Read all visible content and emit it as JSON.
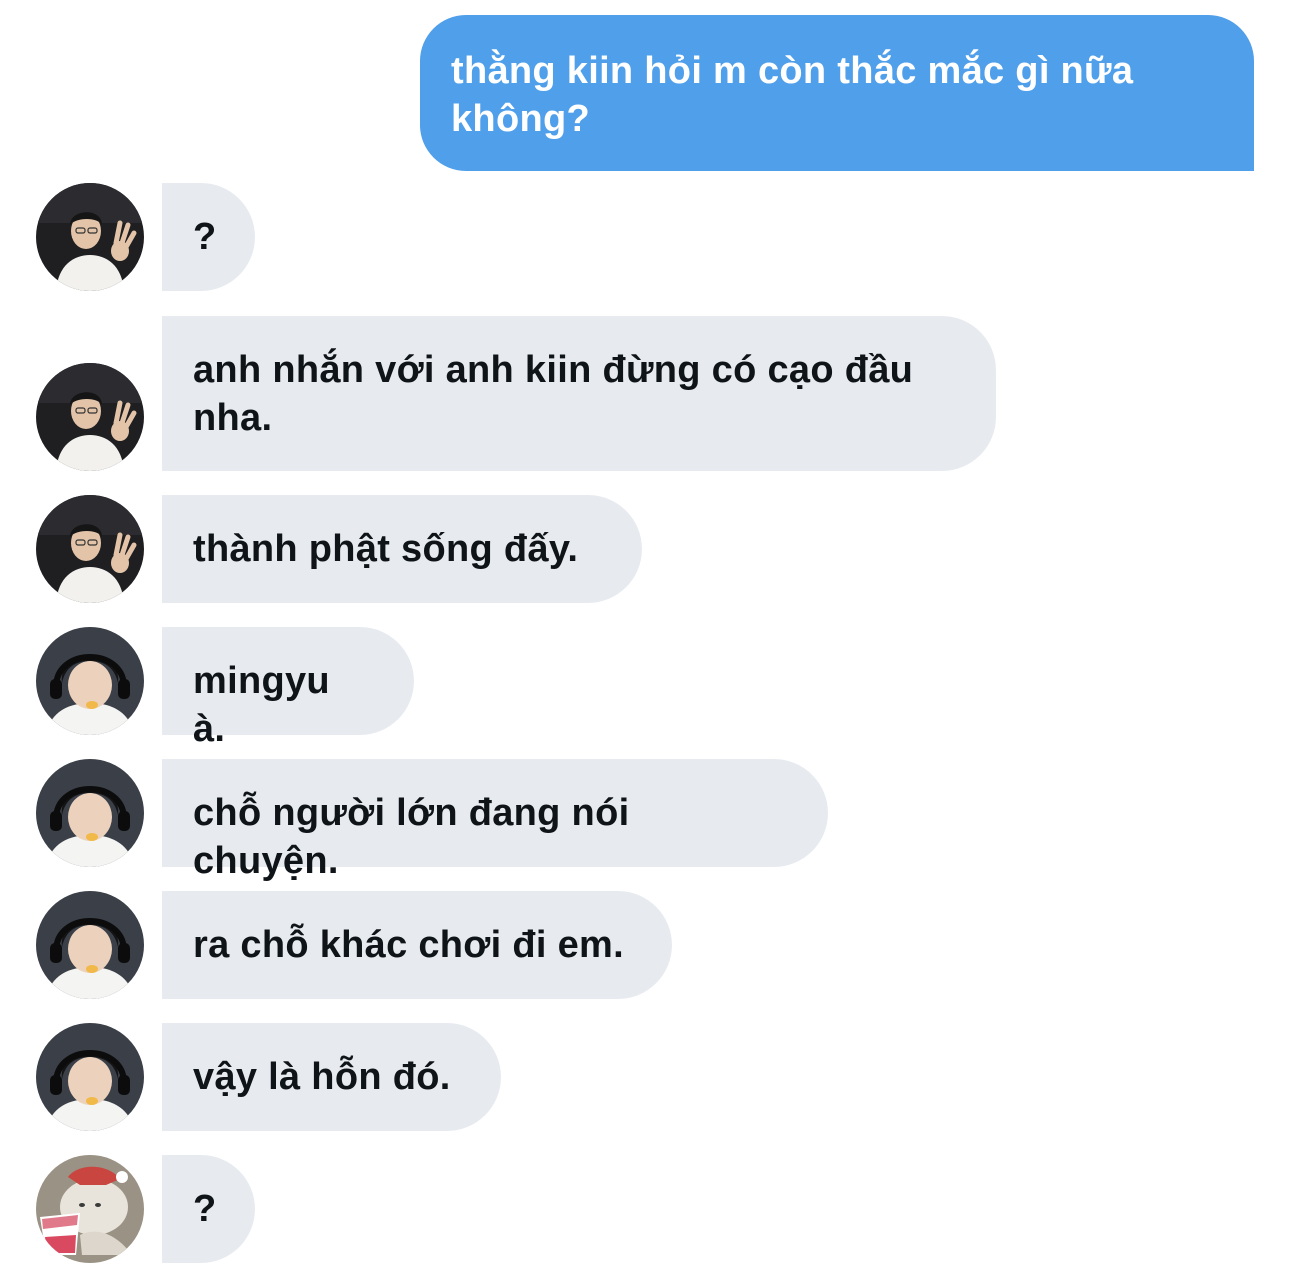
{
  "conversation": {
    "sent": {
      "text": "thằng kiin hỏi m còn thắc mắc gì nữa không?"
    },
    "received": [
      {
        "avatar": "avatar-man-glasses",
        "text": "?"
      },
      {
        "avatar": "avatar-man-glasses",
        "text": "anh nhắn với anh kiin đừng có cạo đầu nha."
      },
      {
        "avatar": "avatar-man-glasses",
        "text": "thành phật sống đấy."
      },
      {
        "avatar": "avatar-boy-headset",
        "text": "mingyu à."
      },
      {
        "avatar": "avatar-boy-headset",
        "text": "chỗ người lớn đang nói chuyện."
      },
      {
        "avatar": "avatar-boy-headset",
        "text": "ra chỗ khác chơi đi em."
      },
      {
        "avatar": "avatar-boy-headset",
        "text": "vậy là hỗn đó."
      },
      {
        "avatar": "avatar-bear-icecream",
        "text": "?"
      }
    ]
  },
  "colors": {
    "sent_bubble": "#4f9fea",
    "received_bubble": "#e7ebf0",
    "received_text": "#0f1419",
    "sent_text": "#ffffff"
  }
}
